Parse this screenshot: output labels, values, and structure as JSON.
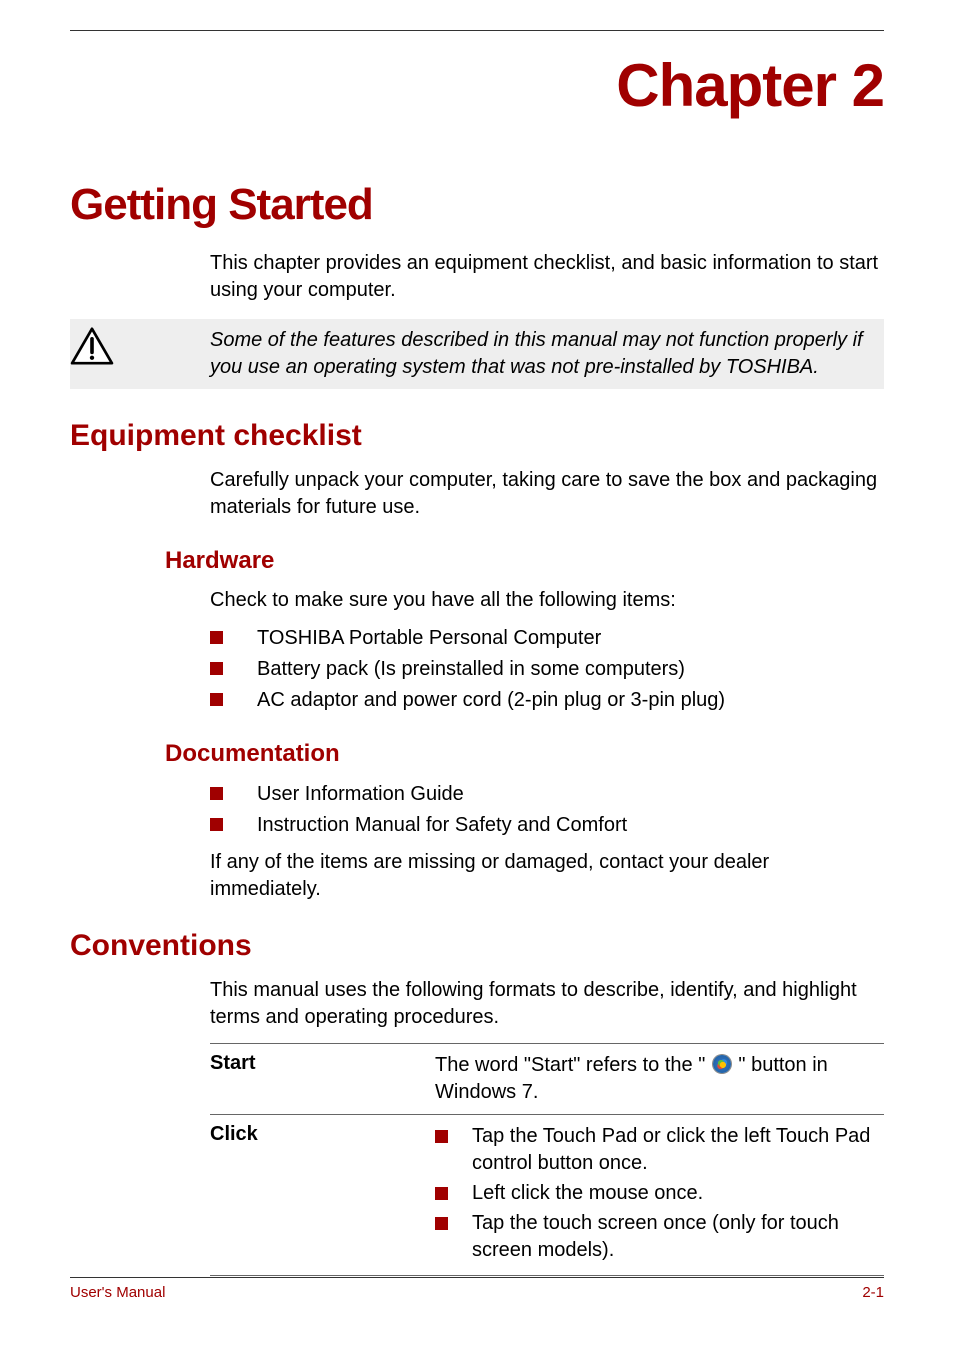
{
  "chapter_label": "Chapter 2",
  "chapter_title": "Getting Started",
  "intro": "This chapter provides an equipment checklist, and basic information to start using your computer.",
  "warning": "Some of the features described in this manual may not function properly if you use an operating system that was not pre-installed by TOSHIBA.",
  "equipment": {
    "heading": "Equipment checklist",
    "intro": "Carefully unpack your computer, taking care to save the box and packaging materials for future use.",
    "hardware": {
      "heading": "Hardware",
      "intro": "Check to make sure you have all the following items:",
      "items": [
        "TOSHIBA Portable Personal Computer",
        "Battery pack (Is preinstalled in some computers)",
        "AC adaptor and power cord (2-pin plug or 3-pin plug)"
      ]
    },
    "documentation": {
      "heading": "Documentation",
      "items": [
        "User Information Guide",
        "Instruction Manual for Safety and Comfort"
      ],
      "note": "If any of the items are missing or damaged, contact your dealer immediately."
    }
  },
  "conventions": {
    "heading": "Conventions",
    "intro": "This manual uses the following formats to describe, identify, and highlight terms and operating procedures.",
    "rows": [
      {
        "key": "Start",
        "value_before": "The word \"Start\" refers to the \" ",
        "value_after": " \" button in Windows 7."
      },
      {
        "key": "Click",
        "items": [
          "Tap the Touch Pad or click the left Touch Pad control button once.",
          "Left click the mouse once.",
          "Tap the touch screen once (only for touch screen models)."
        ]
      }
    ]
  },
  "footer": {
    "left": "User's Manual",
    "right": "2-1"
  }
}
